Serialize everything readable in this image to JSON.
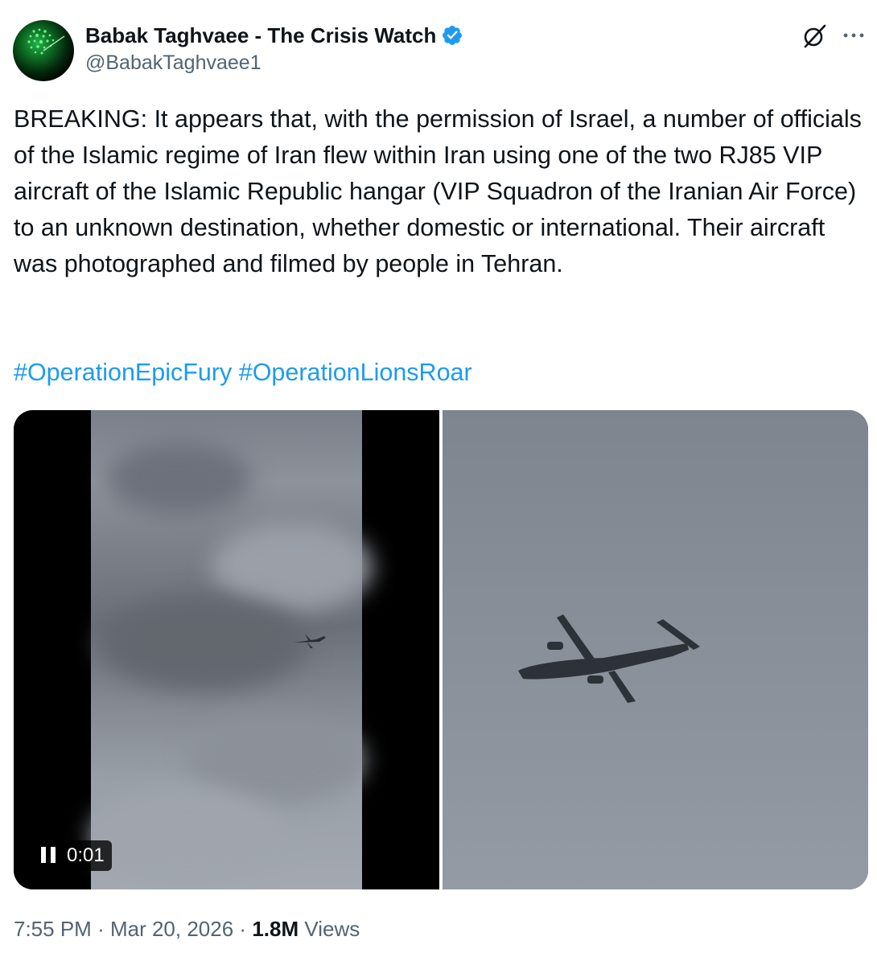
{
  "author": {
    "display_name": "Babak Taghvaee - The Crisis Watch",
    "handle": "@BabakTaghvaee1",
    "verified": true,
    "avatar_icon": "radar-avatar"
  },
  "header_actions": {
    "grok_icon": "grok-icon",
    "more_icon": "more-options-icon"
  },
  "tweet": {
    "text": "BREAKING: It appears that, with the permission of Israel, a number of officials of the Islamic regime of Iran flew within Iran using one of the two RJ85 VIP aircraft of the Islamic Republic hangar (VIP Squadron of the Iranian Air Force) to an unknown destination, whether domestic or international. Their aircraft was photographed and filmed by people in Tehran.",
    "hashtags": [
      "#OperationEpicFury",
      "#OperationLionsRoar"
    ]
  },
  "media": {
    "video_time": "0:01",
    "player_state_icon": "pause-icon"
  },
  "meta": {
    "time": "7:55 PM",
    "separator": "·",
    "date": "Mar 20, 2026",
    "views_count": "1.8M",
    "views_label": "Views"
  },
  "colors": {
    "text_primary": "#0f1419",
    "text_secondary": "#536471",
    "link": "#1d9bf0",
    "verified_badge": "#1d9bf0"
  }
}
